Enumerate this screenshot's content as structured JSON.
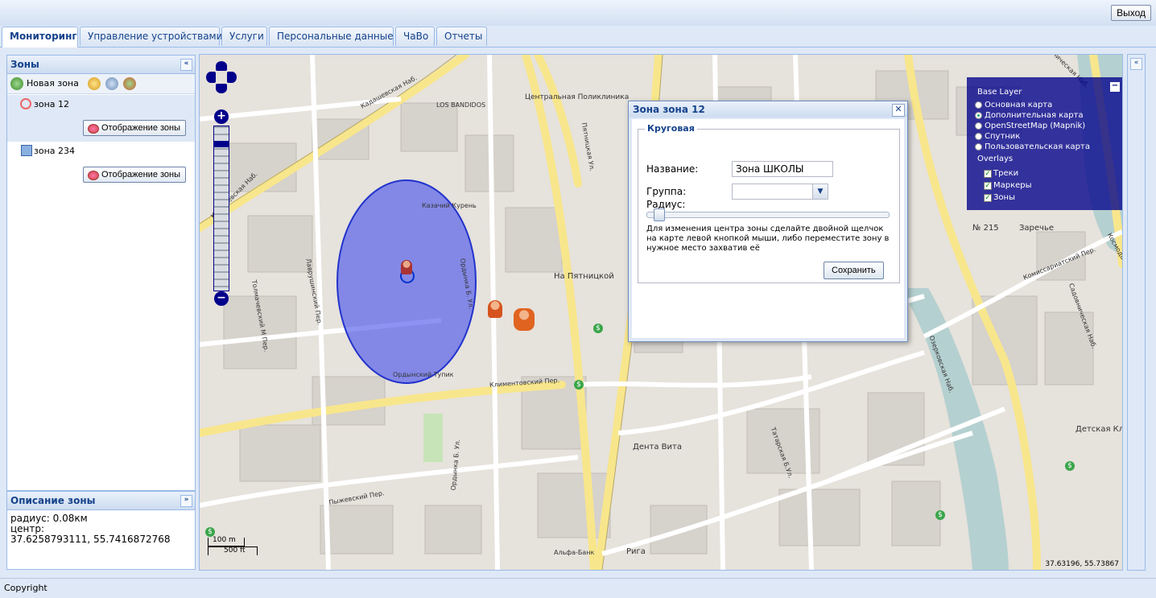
{
  "header": {
    "logout_label": "Выход"
  },
  "tabs": [
    {
      "label": "Мониторинг",
      "active": true
    },
    {
      "label": "Управление устройствами"
    },
    {
      "label": "Услуги"
    },
    {
      "label": "Персональные данные"
    },
    {
      "label": "ЧаВо"
    },
    {
      "label": "Отчеты"
    }
  ],
  "zones_panel": {
    "title": "Зоны",
    "new_zone_label": "Новая зона",
    "zones": [
      {
        "name": "зона 12",
        "button": "Отображение зоны"
      },
      {
        "name": "зона 234",
        "button": "Отображение зоны"
      }
    ]
  },
  "desc_panel": {
    "title": "Описание зоны",
    "radius": "радиус: 0.08км",
    "center_label": "центр:",
    "center_value": "37.6258793111, 55.7416872768"
  },
  "dialog": {
    "title": "Зона зона 12",
    "legend": "Круговая",
    "name_label": "Название:",
    "name_value": "Зона ШКОЛЫ",
    "group_label": "Группа:",
    "radius_label": "Радиус:",
    "radius_slider_fraction": 0.02,
    "hint": "Для изменения центра зоны сделайте двойной щелчок на карте левой кнопкой мыши, либо переместите зону в нужное место захватив её",
    "save_label": "Сохранить"
  },
  "layers": {
    "base_title": "Base Layer",
    "base": [
      {
        "label": "Основная карта",
        "selected": false
      },
      {
        "label": "Дополнительная карта",
        "selected": true
      },
      {
        "label": "OpenStreetMap (Mapnik)",
        "selected": false
      },
      {
        "label": "Спутник",
        "selected": false
      },
      {
        "label": "Пользовательская карта",
        "selected": false
      }
    ],
    "overlays_title": "Overlays",
    "overlays": [
      {
        "label": "Треки",
        "checked": true
      },
      {
        "label": "Маркеры",
        "checked": true
      },
      {
        "label": "Зоны",
        "checked": true
      }
    ]
  },
  "map": {
    "coords": "37.63196, 55.73867",
    "scale_m": "100 m",
    "scale_ft": "500 ft",
    "labels": {
      "kadashevskaya": "Кадашевская Наб.",
      "pyatnitskaya": "Пятницкая Ул.",
      "ordynka": "Ордынка Б. Ул.",
      "sadovnicheskaya": "Садовническая Наб.",
      "ozerkovskaya": "Озерковская Наб.",
      "klimentovsky": "Климентовский Пер.",
      "ordynsky": "Ордынский Тупик",
      "tolmachevsky": "Толмачевский М Пер.",
      "lavrushinsky": "Лаврушинский Пер.",
      "pyzhevsky": "Пыжевский Пер.",
      "tatarskaya": "Татарская Б.Ул.",
      "kosmodamianskaya": "Космодамианская Наб.",
      "kommissariatsky": "Комиссариатский Пер.",
      "na_pyatnitskoy": "На Пятницкой",
      "zarechye": "Заречье",
      "polyclinic": "Центральная Поликлиника",
      "denta": "Дента Вита",
      "riga": "Рига",
      "alfabank": "Альфа-Банк",
      "kazachiy": "Казачий Курень",
      "los_bandidos": "LOS BANDIDOS",
      "detskaya": "Детская Клини",
      "school": "№ 215"
    }
  }
}
